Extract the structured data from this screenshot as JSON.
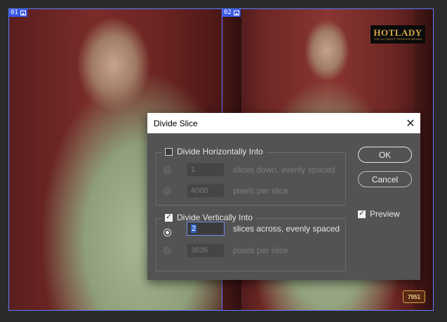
{
  "slices": [
    {
      "number": "01"
    },
    {
      "number": "02"
    }
  ],
  "logo": {
    "brand": "HOTLADY",
    "tagline": "THE ULTIMATE FASHION BRAND"
  },
  "product_code": "7951",
  "dialog": {
    "title": "Divide Slice",
    "horizontal": {
      "label": "Divide Horizontally Into",
      "checked": false,
      "slices_value": "1",
      "slices_label": "slices down, evenly spaced",
      "pixels_value": "4000",
      "pixels_label": "pixels per slice"
    },
    "vertical": {
      "label": "Divide Vertically Into",
      "checked": true,
      "slices_value": "2",
      "slices_label": "slices across, evenly spaced",
      "pixels_value": "3636",
      "pixels_label": "pixels per slice"
    },
    "ok_label": "OK",
    "cancel_label": "Cancel",
    "preview_label": "Preview",
    "preview_checked": true
  },
  "colors": {
    "slice_border": "#5b7bff",
    "dialog_bg": "#535353",
    "selection": "#2d62c8"
  }
}
